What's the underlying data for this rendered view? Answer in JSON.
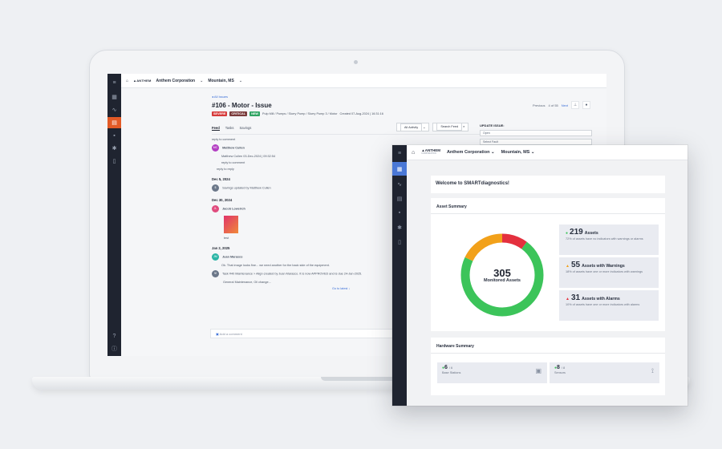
{
  "back_app": {
    "org": "Anthem Corporation",
    "site": "Mountain, MS",
    "back_link": "All Issues",
    "issue_title": "#106 - Motor - Issue",
    "tags": [
      "SEVERE",
      "CRITICAL",
      "NEW"
    ],
    "tag_colors": [
      "#d63a3a",
      "#7a3b3b",
      "#2fa463"
    ],
    "breadcrumb": "Pulp Mill / Pumps / Slurry Pump / Slurry Pump 3 / Motor",
    "created": "Created 07-Aug-2024 | 16:31:16",
    "pager": {
      "prev": "Previous",
      "count": "4 of 55",
      "next": "Next"
    },
    "tabs": [
      "Feed",
      "Tasks",
      "Savings"
    ],
    "filter_label": "All Activity",
    "search_placeholder": "Search Feed",
    "update_label": "UPDATE ISSUE:",
    "update_status": "Open",
    "update_select": "Select Fault",
    "feed": {
      "reply1": "reply to comment",
      "user1": "Matthew Cullen",
      "user1_initials": "MC",
      "user1_meta": "Matthew Cullen  03-Dec-2024 | 09:32:54",
      "reply2": "reply to comment",
      "reply3": "reply to reply",
      "date1": "Dec 5, 2024",
      "savings_text": "Savings updated by Matthew Cullen",
      "date2": "Dec 30, 2024",
      "user2": "Jacob Lowerich",
      "user2_initials": "JL",
      "caption": "test",
      "date3": "Jan 2, 2025",
      "user3": "Juan Marasco",
      "user3_initials": "JM",
      "comment3": "Ok. That image looks fine... we need another for the back side of the equipment.",
      "task_text": "Task #40 Maintenance > Align created by Juan Marasco. It is now APPROVED and is due 24-Jan-2025.",
      "task_detail": "General Maintenance, Oil change...",
      "goto_latest": "Go to latest"
    },
    "comment_placeholder": "Add a comment"
  },
  "dashboard": {
    "brand": "ANTHEM",
    "brand_sub": "CORPORATION",
    "org": "Anthem Corporation",
    "site": "Mountain, MS",
    "welcome": "Welcome to SMARTdiagnostics!",
    "asset_summary_title": "Asset Summary",
    "monitored_count": "305",
    "monitored_label": "Monitored Assets",
    "stats": [
      {
        "count": "219",
        "label": "Assets",
        "desc": "72% of assets have no indicators with warnings or alarms",
        "color": "#3cc45a"
      },
      {
        "count": "55",
        "label": "Assets with Warnings",
        "desc": "18% of assets have one or more indicators with warnings",
        "color": "#f2a11a"
      },
      {
        "count": "31",
        "label": "Assets with Alarms",
        "desc": "10% of assets have one or more indicators with alarms",
        "color": "#e4303e"
      }
    ],
    "donut_values": [
      219,
      55,
      31
    ],
    "hardware_title": "Hardware Summary",
    "hardware": [
      {
        "count": "6",
        "of": "/ 6",
        "name": "Base Stations",
        "icon": "router-icon"
      },
      {
        "count": "8",
        "of": "/ 8",
        "name": "Sensors",
        "icon": "sensor-icon"
      }
    ]
  }
}
